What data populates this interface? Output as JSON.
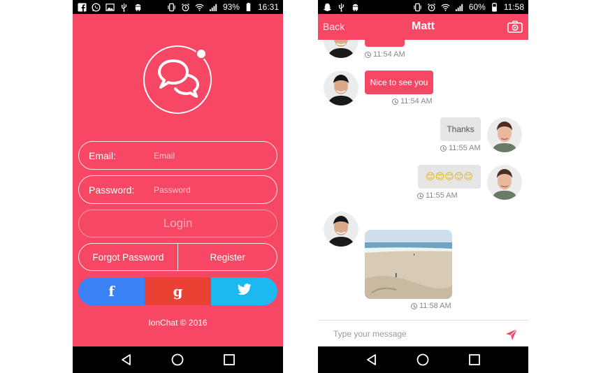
{
  "login_screen": {
    "statusbar": {
      "battery": "93%",
      "time": "16:31",
      "left_icons": [
        "facebook-icon",
        "whatsapp-icon",
        "gallery-icon",
        "usb-icon",
        "android-icon"
      ]
    },
    "email": {
      "label": "Email:",
      "placeholder": "Email"
    },
    "password": {
      "label": "Password:",
      "placeholder": "Password"
    },
    "login_label": "Login",
    "forgot_label": "Forgot Password",
    "register_label": "Register",
    "social": {
      "facebook_glyph": "f",
      "google_glyph": "g",
      "colors": {
        "facebook": "#3b82f6",
        "google": "#e94235",
        "twitter": "#1cb8f0"
      }
    },
    "copyright": "IonChat © 2016",
    "theme_color": "#f64764"
  },
  "chat_screen": {
    "statusbar": {
      "battery": "60%",
      "time": "11:58",
      "left_icons": [
        "snapchat-icon",
        "usb-icon",
        "android-icon"
      ]
    },
    "header": {
      "back_label": "Back",
      "title": "Matt"
    },
    "messages": [
      {
        "from": "other",
        "text": "",
        "time": "11:54 AM"
      },
      {
        "from": "other",
        "text": "Nice to see you",
        "time": "11:54 AM"
      },
      {
        "from": "me",
        "text": "Thanks",
        "time": "11:55 AM"
      },
      {
        "from": "me",
        "text": "😊😊😊😊😊",
        "time": "11:55 AM"
      },
      {
        "from": "other",
        "type": "image",
        "time": "11:58 AM"
      }
    ],
    "composer": {
      "placeholder": "Type your message"
    }
  }
}
